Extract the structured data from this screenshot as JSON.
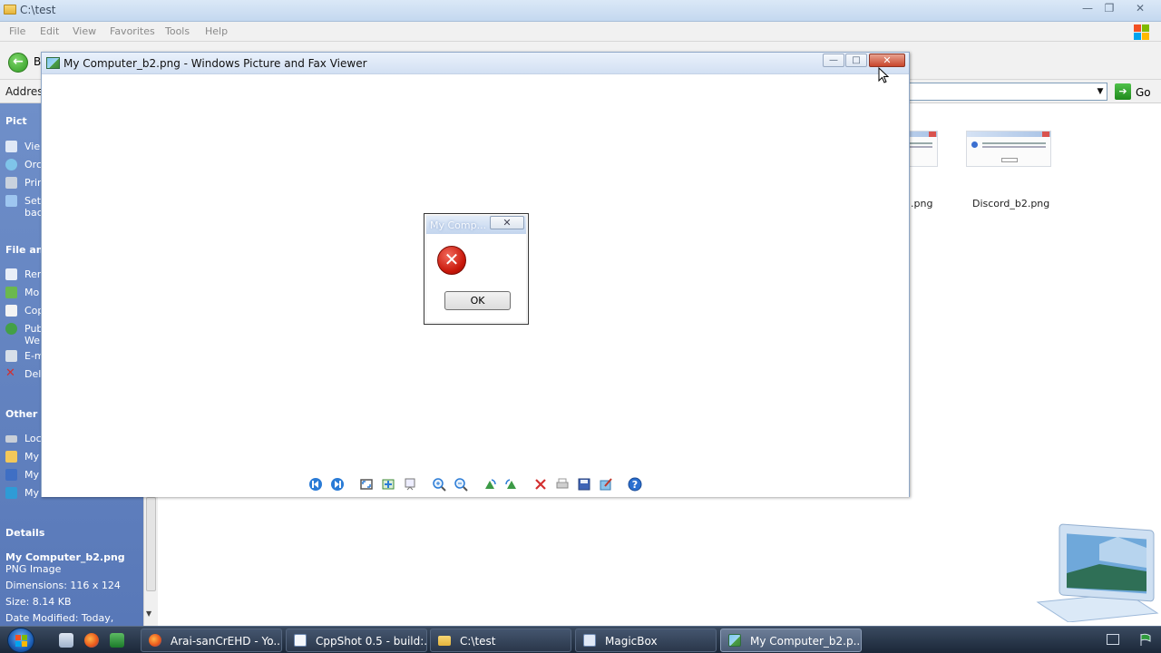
{
  "explorer": {
    "title": "C:\\test",
    "menu": [
      "File",
      "Edit",
      "View",
      "Favorites",
      "Tools",
      "Help"
    ],
    "back_label": "B",
    "address_label": "Address",
    "go_label": "Go",
    "pane": {
      "picture_tasks_heading": "Pict",
      "picture_tasks": [
        "Vie",
        "Orc",
        "Prir",
        "Set bac"
      ],
      "file_tasks_heading": "File and",
      "file_tasks": [
        "Rer",
        "Mo",
        "Cop",
        "Pub We",
        "E-m",
        "Del"
      ],
      "other_places_heading": "Other P",
      "other_places": [
        "Loc",
        "My",
        "My",
        "My"
      ],
      "details_heading": "Details",
      "details": {
        "name": "My Computer_b2.png",
        "type": "PNG Image",
        "dimensions": "Dimensions: 116 x 124",
        "size": "Size: 8.14 KB",
        "modified": "Date Modified: Today,"
      }
    },
    "files": [
      {
        "label": ".png"
      },
      {
        "label": "Discord_b2.png"
      }
    ]
  },
  "viewer": {
    "title": "My Computer_b2.png - Windows Picture and Fax Viewer",
    "minimize_label": "—",
    "maximize_label": "□",
    "close_label": "✕"
  },
  "dialog": {
    "title": "My Comp...",
    "close_label": "✕",
    "error_glyph": "✕",
    "ok_label": "OK"
  },
  "taskbar": {
    "tasks": [
      {
        "label": "Arai-sanCrEHD - Yo..."
      },
      {
        "label": "CppShot 0.5 - build:..."
      },
      {
        "label": "C:\\test"
      },
      {
        "label": "MagicBox"
      },
      {
        "label": "My Computer_b2.p..."
      }
    ]
  },
  "colors": {
    "task_pane": "#6f8fc9",
    "close_button": "#c8452b",
    "error_red": "#c8170a"
  }
}
